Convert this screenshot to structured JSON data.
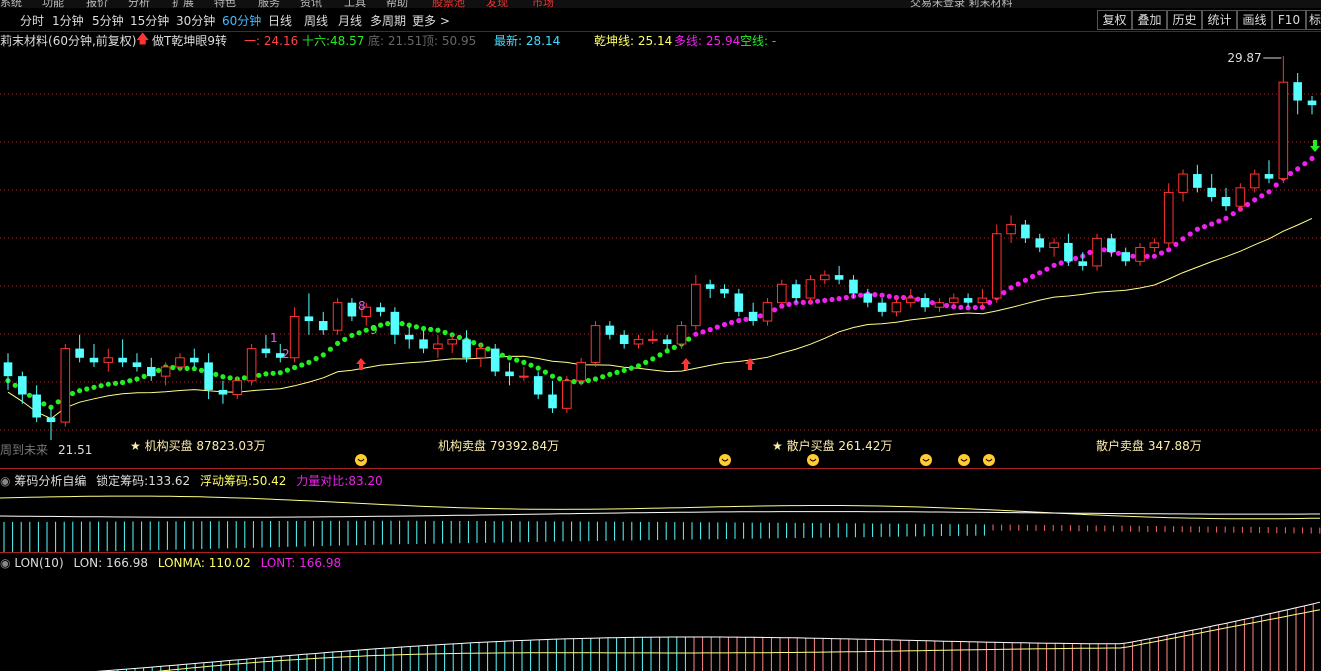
{
  "top_menu": {
    "items": [
      "系统",
      "功能",
      "报价",
      "分析",
      "扩展",
      "特色",
      "服务",
      "资讯",
      "工具",
      "帮助"
    ],
    "highlight_items": [
      "股票池",
      "发现",
      "市场"
    ],
    "right_title": "交易未登录   莉末材料"
  },
  "period_bar": {
    "items": [
      "分时",
      "1分钟",
      "5分钟",
      "15分钟",
      "30分钟",
      "60分钟",
      "日线",
      "周线",
      "月线",
      "多周期",
      "更多 >"
    ],
    "active": "60分钟",
    "right_buttons": [
      "复权",
      "叠加",
      "历史",
      "统计",
      "画线",
      "F10",
      "标"
    ]
  },
  "info_line": {
    "stock_name": "莉末材料",
    "period_desc": "(60分钟,前复权)",
    "indicator_name": "做T乾坤眼9转",
    "one_label": "一:",
    "one_value": "24.16",
    "sixteen_label": "十六:",
    "sixteen_value": "48.57",
    "bottom_label": "底:",
    "bottom_value": "21.51",
    "top_label": "顶:",
    "top_value": "50.95",
    "latest_label": "最新:",
    "latest_value": "28.14",
    "qiankun_label": "乾坤线:",
    "qiankun_value": "25.14",
    "duo_label": "多线:",
    "duo_value": "25.94",
    "kong_label": "空线:",
    "kong_value": "-"
  },
  "main_chart": {
    "high_label": "29.87",
    "low_label": "21.51",
    "low_prefix": "周到未来",
    "seq_labels": [
      "1",
      "2",
      "8",
      "9"
    ],
    "flow_labels": [
      {
        "text": "★ 机构买盘  87823.03万",
        "color": "#ffeeaa"
      },
      {
        "text": "机构卖盘  79392.84万",
        "color": "#ffeeaa"
      },
      {
        "text": "★ 散户买盘  261.42万",
        "color": "#ffeeaa"
      },
      {
        "text": "散户卖盘  347.88万",
        "color": "#ffeeaa"
      }
    ],
    "colors": {
      "up": "#ff3333",
      "down": "#55ffff",
      "ma": "#ffff88",
      "green_dots": "#22ee22",
      "magenta_dots": "#ee22ee",
      "grid": "#aa2222"
    }
  },
  "panel2": {
    "title": "筹码分析自编",
    "locked_label": "锁定筹码:",
    "locked_value": "133.62",
    "float_label": "浮动筹码:",
    "float_value": "50.42",
    "power_label": "力量对比:",
    "power_value": "83.20"
  },
  "panel3": {
    "title": "LON(10)",
    "lon_label": "LON:",
    "lon_value": "166.98",
    "lonma_label": "LONMA:",
    "lonma_value": "110.02",
    "lont_label": "LONT:",
    "lont_value": "166.98"
  },
  "chart_data": {
    "type": "candlestick",
    "title": "",
    "ylim": [
      21.51,
      29.87
    ],
    "candles": [
      {
        "o": 23.2,
        "h": 23.4,
        "l": 22.6,
        "c": 22.9
      },
      {
        "o": 22.9,
        "h": 23.0,
        "l": 22.3,
        "c": 22.5
      },
      {
        "o": 22.5,
        "h": 22.7,
        "l": 21.9,
        "c": 22.0
      },
      {
        "o": 22.0,
        "h": 22.2,
        "l": 21.51,
        "c": 21.9
      },
      {
        "o": 21.9,
        "h": 23.6,
        "l": 21.8,
        "c": 23.5
      },
      {
        "o": 23.5,
        "h": 23.8,
        "l": 23.2,
        "c": 23.3
      },
      {
        "o": 23.3,
        "h": 23.6,
        "l": 23.1,
        "c": 23.2
      },
      {
        "o": 23.2,
        "h": 23.5,
        "l": 23.0,
        "c": 23.3
      },
      {
        "o": 23.3,
        "h": 23.7,
        "l": 23.1,
        "c": 23.2
      },
      {
        "o": 23.2,
        "h": 23.4,
        "l": 23.0,
        "c": 23.1
      },
      {
        "o": 23.1,
        "h": 23.3,
        "l": 22.8,
        "c": 22.9
      },
      {
        "o": 22.9,
        "h": 23.2,
        "l": 22.7,
        "c": 23.1
      },
      {
        "o": 23.1,
        "h": 23.4,
        "l": 23.0,
        "c": 23.3
      },
      {
        "o": 23.3,
        "h": 23.5,
        "l": 23.1,
        "c": 23.2
      },
      {
        "o": 23.2,
        "h": 23.4,
        "l": 22.4,
        "c": 22.6
      },
      {
        "o": 22.6,
        "h": 22.8,
        "l": 22.3,
        "c": 22.5
      },
      {
        "o": 22.5,
        "h": 22.9,
        "l": 22.4,
        "c": 22.8
      },
      {
        "o": 22.8,
        "h": 23.6,
        "l": 22.7,
        "c": 23.5
      },
      {
        "o": 23.5,
        "h": 23.8,
        "l": 23.3,
        "c": 23.4
      },
      {
        "o": 23.4,
        "h": 23.6,
        "l": 23.2,
        "c": 23.3
      },
      {
        "o": 23.3,
        "h": 24.4,
        "l": 23.2,
        "c": 24.2
      },
      {
        "o": 24.2,
        "h": 24.7,
        "l": 23.8,
        "c": 24.1
      },
      {
        "o": 24.1,
        "h": 24.3,
        "l": 23.8,
        "c": 23.9
      },
      {
        "o": 23.9,
        "h": 24.6,
        "l": 23.8,
        "c": 24.5
      },
      {
        "o": 24.5,
        "h": 24.6,
        "l": 24.1,
        "c": 24.2
      },
      {
        "o": 24.2,
        "h": 24.5,
        "l": 24.0,
        "c": 24.4
      },
      {
        "o": 24.4,
        "h": 24.5,
        "l": 24.2,
        "c": 24.3
      },
      {
        "o": 24.3,
        "h": 24.4,
        "l": 23.6,
        "c": 23.8
      },
      {
        "o": 23.8,
        "h": 24.0,
        "l": 23.5,
        "c": 23.7
      },
      {
        "o": 23.7,
        "h": 23.9,
        "l": 23.4,
        "c": 23.5
      },
      {
        "o": 23.5,
        "h": 23.8,
        "l": 23.3,
        "c": 23.6
      },
      {
        "o": 23.6,
        "h": 23.8,
        "l": 23.4,
        "c": 23.7
      },
      {
        "o": 23.7,
        "h": 23.9,
        "l": 23.2,
        "c": 23.3
      },
      {
        "o": 23.3,
        "h": 23.6,
        "l": 23.1,
        "c": 23.5
      },
      {
        "o": 23.5,
        "h": 23.6,
        "l": 22.9,
        "c": 23.0
      },
      {
        "o": 23.0,
        "h": 23.2,
        "l": 22.7,
        "c": 22.9
      },
      {
        "o": 22.9,
        "h": 23.1,
        "l": 22.8,
        "c": 22.9
      },
      {
        "o": 22.9,
        "h": 23.0,
        "l": 22.4,
        "c": 22.5
      },
      {
        "o": 22.5,
        "h": 22.8,
        "l": 22.1,
        "c": 22.2
      },
      {
        "o": 22.2,
        "h": 22.9,
        "l": 22.1,
        "c": 22.8
      },
      {
        "o": 22.8,
        "h": 23.3,
        "l": 22.7,
        "c": 23.2
      },
      {
        "o": 23.2,
        "h": 24.1,
        "l": 23.1,
        "c": 24.0
      },
      {
        "o": 24.0,
        "h": 24.1,
        "l": 23.7,
        "c": 23.8
      },
      {
        "o": 23.8,
        "h": 23.9,
        "l": 23.5,
        "c": 23.6
      },
      {
        "o": 23.6,
        "h": 23.8,
        "l": 23.5,
        "c": 23.7
      },
      {
        "o": 23.7,
        "h": 23.9,
        "l": 23.6,
        "c": 23.7
      },
      {
        "o": 23.7,
        "h": 23.8,
        "l": 23.5,
        "c": 23.6
      },
      {
        "o": 23.6,
        "h": 24.1,
        "l": 23.5,
        "c": 24.0
      },
      {
        "o": 24.0,
        "h": 25.1,
        "l": 23.9,
        "c": 24.9
      },
      {
        "o": 24.9,
        "h": 25.0,
        "l": 24.6,
        "c": 24.8
      },
      {
        "o": 24.8,
        "h": 24.9,
        "l": 24.6,
        "c": 24.7
      },
      {
        "o": 24.7,
        "h": 24.8,
        "l": 24.2,
        "c": 24.3
      },
      {
        "o": 24.3,
        "h": 24.5,
        "l": 24.0,
        "c": 24.1
      },
      {
        "o": 24.1,
        "h": 24.6,
        "l": 24.0,
        "c": 24.5
      },
      {
        "o": 24.5,
        "h": 25.0,
        "l": 24.4,
        "c": 24.9
      },
      {
        "o": 24.9,
        "h": 25.0,
        "l": 24.5,
        "c": 24.6
      },
      {
        "o": 24.6,
        "h": 25.1,
        "l": 24.5,
        "c": 25.0
      },
      {
        "o": 25.0,
        "h": 25.2,
        "l": 24.9,
        "c": 25.1
      },
      {
        "o": 25.1,
        "h": 25.3,
        "l": 24.9,
        "c": 25.0
      },
      {
        "o": 25.0,
        "h": 25.1,
        "l": 24.6,
        "c": 24.7
      },
      {
        "o": 24.7,
        "h": 24.8,
        "l": 24.4,
        "c": 24.5
      },
      {
        "o": 24.5,
        "h": 24.6,
        "l": 24.2,
        "c": 24.3
      },
      {
        "o": 24.3,
        "h": 24.6,
        "l": 24.2,
        "c": 24.5
      },
      {
        "o": 24.5,
        "h": 24.8,
        "l": 24.4,
        "c": 24.6
      },
      {
        "o": 24.6,
        "h": 24.7,
        "l": 24.3,
        "c": 24.4
      },
      {
        "o": 24.4,
        "h": 24.6,
        "l": 24.3,
        "c": 24.5
      },
      {
        "o": 24.5,
        "h": 24.7,
        "l": 24.4,
        "c": 24.6
      },
      {
        "o": 24.6,
        "h": 24.7,
        "l": 24.4,
        "c": 24.5
      },
      {
        "o": 24.5,
        "h": 24.8,
        "l": 24.4,
        "c": 24.6
      },
      {
        "o": 24.6,
        "h": 26.2,
        "l": 24.5,
        "c": 26.0
      },
      {
        "o": 26.0,
        "h": 26.4,
        "l": 25.8,
        "c": 26.2
      },
      {
        "o": 26.2,
        "h": 26.3,
        "l": 25.8,
        "c": 25.9
      },
      {
        "o": 25.9,
        "h": 26.0,
        "l": 25.6,
        "c": 25.7
      },
      {
        "o": 25.7,
        "h": 25.9,
        "l": 25.5,
        "c": 25.8
      },
      {
        "o": 25.8,
        "h": 26.0,
        "l": 25.3,
        "c": 25.4
      },
      {
        "o": 25.4,
        "h": 25.6,
        "l": 25.2,
        "c": 25.3
      },
      {
        "o": 25.3,
        "h": 26.0,
        "l": 25.2,
        "c": 25.9
      },
      {
        "o": 25.9,
        "h": 26.0,
        "l": 25.5,
        "c": 25.6
      },
      {
        "o": 25.6,
        "h": 25.7,
        "l": 25.3,
        "c": 25.4
      },
      {
        "o": 25.4,
        "h": 25.8,
        "l": 25.3,
        "c": 25.7
      },
      {
        "o": 25.7,
        "h": 25.9,
        "l": 25.6,
        "c": 25.8
      },
      {
        "o": 25.8,
        "h": 27.1,
        "l": 25.7,
        "c": 26.9
      },
      {
        "o": 26.9,
        "h": 27.4,
        "l": 26.7,
        "c": 27.3
      },
      {
        "o": 27.3,
        "h": 27.5,
        "l": 26.9,
        "c": 27.0
      },
      {
        "o": 27.0,
        "h": 27.3,
        "l": 26.7,
        "c": 26.8
      },
      {
        "o": 26.8,
        "h": 27.0,
        "l": 26.5,
        "c": 26.6
      },
      {
        "o": 26.6,
        "h": 27.1,
        "l": 26.5,
        "c": 27.0
      },
      {
        "o": 27.0,
        "h": 27.4,
        "l": 26.9,
        "c": 27.3
      },
      {
        "o": 27.3,
        "h": 27.6,
        "l": 27.1,
        "c": 27.2
      },
      {
        "o": 27.2,
        "h": 29.87,
        "l": 27.1,
        "c": 29.3
      },
      {
        "o": 29.3,
        "h": 29.5,
        "l": 28.6,
        "c": 28.9
      },
      {
        "o": 28.9,
        "h": 29.0,
        "l": 28.6,
        "c": 28.8
      }
    ]
  }
}
